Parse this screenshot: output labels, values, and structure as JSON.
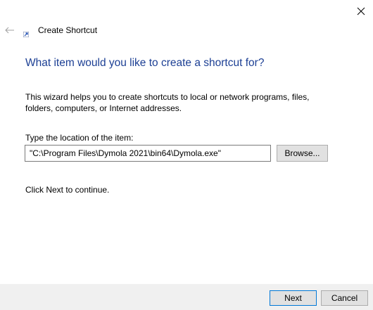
{
  "window": {
    "title": "Create Shortcut",
    "close_icon": "close-icon",
    "back_icon": "back-arrow-icon",
    "app_icon": "shortcut-icon"
  },
  "main": {
    "heading": "What item would you like to create a shortcut for?",
    "description": "This wizard helps you to create shortcuts to local or network programs, files, folders, computers, or Internet addresses.",
    "location_label": "Type the location of the item:",
    "location_value": "\"C:\\Program Files\\Dymola 2021\\bin64\\Dymola.exe\"",
    "browse_label": "Browse...",
    "continue_text": "Click Next to continue."
  },
  "footer": {
    "next_label": "Next",
    "cancel_label": "Cancel"
  },
  "colors": {
    "heading": "#1c3f94",
    "footer_bg": "#f0f0f0",
    "button_bg": "#e1e1e1",
    "default_button_border": "#0078d7"
  }
}
